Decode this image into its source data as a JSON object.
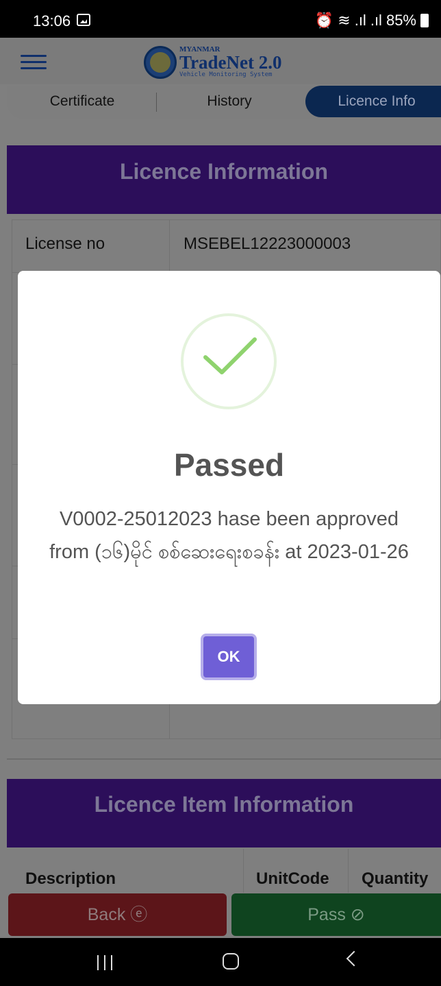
{
  "status_bar": {
    "time": "13:06",
    "battery": "85%",
    "icons": [
      "gallery-icon",
      "alarm-icon",
      "wifi-icon",
      "signal-icon",
      "battery-icon"
    ]
  },
  "app": {
    "logo_top": "MYANMAR",
    "logo_name": "TradeNet 2.0",
    "logo_sub": "Vehicle Monitoring System"
  },
  "tabs": [
    {
      "label": "Certificate"
    },
    {
      "label": "History"
    },
    {
      "label": "Licence Info",
      "active": true
    }
  ],
  "licence_section": {
    "title": "Licence Information",
    "rows": [
      {
        "label": "License no",
        "value": "MSEBEL12223000003"
      }
    ]
  },
  "item_section": {
    "title": "Licence Item Information",
    "columns": [
      "Description",
      "UnitCode",
      "Quantity"
    ]
  },
  "buttons": {
    "back": "Back ⓔ",
    "pass": "Pass ⊘"
  },
  "modal": {
    "title": "Passed",
    "message": "V0002-25012023 hase been approved from (၁၆)မိုင် စစ်ဆေးရေးစခန်း at 2023-01-26",
    "ok": "OK"
  },
  "colors": {
    "accent": "#6f5fd6",
    "success_check": "#8fd36e",
    "header_purple": "#5b1cb4",
    "back_red": "#b92b33",
    "pass_green": "#1f8a3e"
  }
}
